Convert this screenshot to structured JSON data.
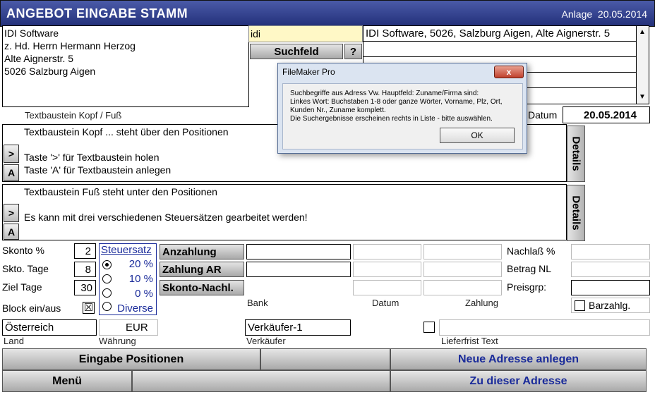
{
  "header": {
    "title": "ANGEBOT EINGABE STAMM",
    "status_label": "Anlage",
    "date": "20.05.2014"
  },
  "address": {
    "lines": [
      "IDI Software",
      "z. Hd. Herrn Hermann Herzog",
      "Alte Aignerstr. 5",
      "5026 Salzburg Aigen"
    ]
  },
  "search": {
    "value": "idi",
    "button_label": "Suchfeld",
    "help_label": "?",
    "results": [
      "IDI Software, 5026, Salzburg Aigen, Alte Aignerstr. 5",
      "",
      "",
      "",
      ""
    ]
  },
  "textblock": {
    "section_label": "Textbaustein Kopf / Fuß",
    "head_text": "Textbaustein Kopf ... steht über den Positionen\n\nTaste '>' für Textbaustein holen\nTaste 'A' für Textbaustein anlegen",
    "foot_text": "Textbaustein Fuß steht unter den Positionen\n\nEs kann mit drei verschiedenen Steuersätzen gearbeitet werden!",
    "fetch_label": ">",
    "create_label": "A",
    "details_label": "Details"
  },
  "date_field": {
    "label": "Datum",
    "value": "20.05.2014"
  },
  "terms": {
    "skonto_label": "Skonto %",
    "skonto_value": "2",
    "skto_tage_label": "Skto. Tage",
    "skto_tage_value": "8",
    "ziel_tage_label": "Ziel Tage",
    "ziel_tage_value": "30",
    "block_label": "Block ein/aus",
    "block_checked": "☒"
  },
  "tax": {
    "link_label": "Steuersatz",
    "options": [
      {
        "label": "20 %",
        "selected": true
      },
      {
        "label": "10 %",
        "selected": false
      },
      {
        "label": "0 %",
        "selected": false
      },
      {
        "label": "Diverse",
        "selected": false
      }
    ]
  },
  "payments": {
    "anzahlung_label": "Anzahlung",
    "zahlung_ar_label": "Zahlung AR",
    "skonto_nachl_label": "Skonto-Nachl.",
    "col_bank": "Bank",
    "col_datum": "Datum",
    "col_zahlung": "Zahlung"
  },
  "right_fields": {
    "nachlass_label": "Nachlaß %",
    "betrag_nl_label": "Betrag NL",
    "preisgrp_label": "Preisgrp:",
    "barzahlg_label": "Barzahlg."
  },
  "bottom_fields": {
    "land_value": "Österreich",
    "land_label": "Land",
    "waehrung_value": "EUR",
    "waehrung_label": "Währung",
    "verkaeufer_value": "Verkäufer-1",
    "verkaeufer_label": "Verkäufer",
    "lieferfrist_label": "Lieferfrist Text"
  },
  "buttons": {
    "eingabe_positionen": "Eingabe Positionen",
    "neue_adresse": "Neue Adresse anlegen",
    "menue": "Menü",
    "zu_dieser_adresse": "Zu dieser Adresse"
  },
  "dialog": {
    "title": "FileMaker Pro",
    "close_label": "x",
    "message": "Suchbegriffe aus Adress Vw. Hauptfeld: Zuname/Firma sind:\nLinkes Wort: Buchstaben 1-8 oder ganze Wörter, Vorname, Plz, Ort,\nKunden Nr., Zuname komplett.\nDie Suchergebnisse erscheinen rechts in Liste - bitte auswählen.",
    "ok_label": "OK"
  },
  "colors": {
    "header_start": "#4a5aa8",
    "header_end": "#23307a",
    "link": "#1a2b9a",
    "search_bg": "#fff8c6",
    "dialog_bg": "#dbe4f1"
  }
}
